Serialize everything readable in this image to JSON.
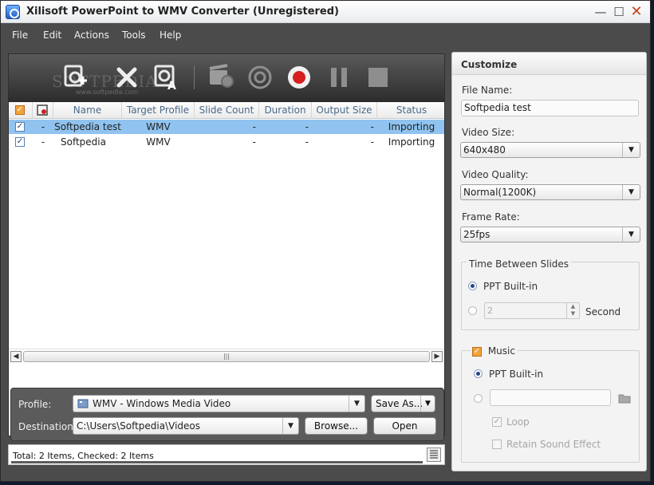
{
  "window": {
    "title": "Xilisoft PowerPoint to WMV Converter (Unregistered)"
  },
  "menu": [
    "File",
    "Edit",
    "Actions",
    "Tools",
    "Help"
  ],
  "toolbar": {
    "watermark": "SOFTPEDIA",
    "watermark_url": "www.softpedia.com"
  },
  "table": {
    "columns": [
      "Name",
      "Target Profile",
      "Slide Count",
      "Duration",
      "Output Size",
      "Status"
    ],
    "rows": [
      {
        "checked": true,
        "flag": "-",
        "name": "Softpedia test",
        "profile": "WMV",
        "slides": "-",
        "duration": "-",
        "size": "-",
        "status": "Importing",
        "selected": true
      },
      {
        "checked": true,
        "flag": "-",
        "name": "Softpedia",
        "profile": "WMV",
        "slides": "-",
        "duration": "-",
        "size": "-",
        "status": "Importing",
        "selected": false
      }
    ]
  },
  "bottom": {
    "profile_label": "Profile:",
    "profile_value": "WMV - Windows Media Video",
    "save_as": "Save As...",
    "destination_label": "Destination:",
    "destination_value": "C:\\Users\\Softpedia\\Videos",
    "browse": "Browse...",
    "open": "Open"
  },
  "status": {
    "text": "Total: 2 Items, Checked: 2 Items"
  },
  "customize": {
    "title": "Customize",
    "file_name_label": "File Name:",
    "file_name_value": "Softpedia test",
    "video_size_label": "Video Size:",
    "video_size_value": "640x480",
    "video_quality_label": "Video Quality:",
    "video_quality_value": "Normal(1200K)",
    "frame_rate_label": "Frame Rate:",
    "frame_rate_value": "25fps",
    "time_group_label": "Time Between Slides",
    "ppt_builtin": "PPT Built-in",
    "seconds_value": "2",
    "second_label": "Second",
    "music_label": "Music",
    "music_ppt_builtin": "PPT Built-in",
    "loop_label": "Loop",
    "retain_label": "Retain Sound Effect"
  }
}
